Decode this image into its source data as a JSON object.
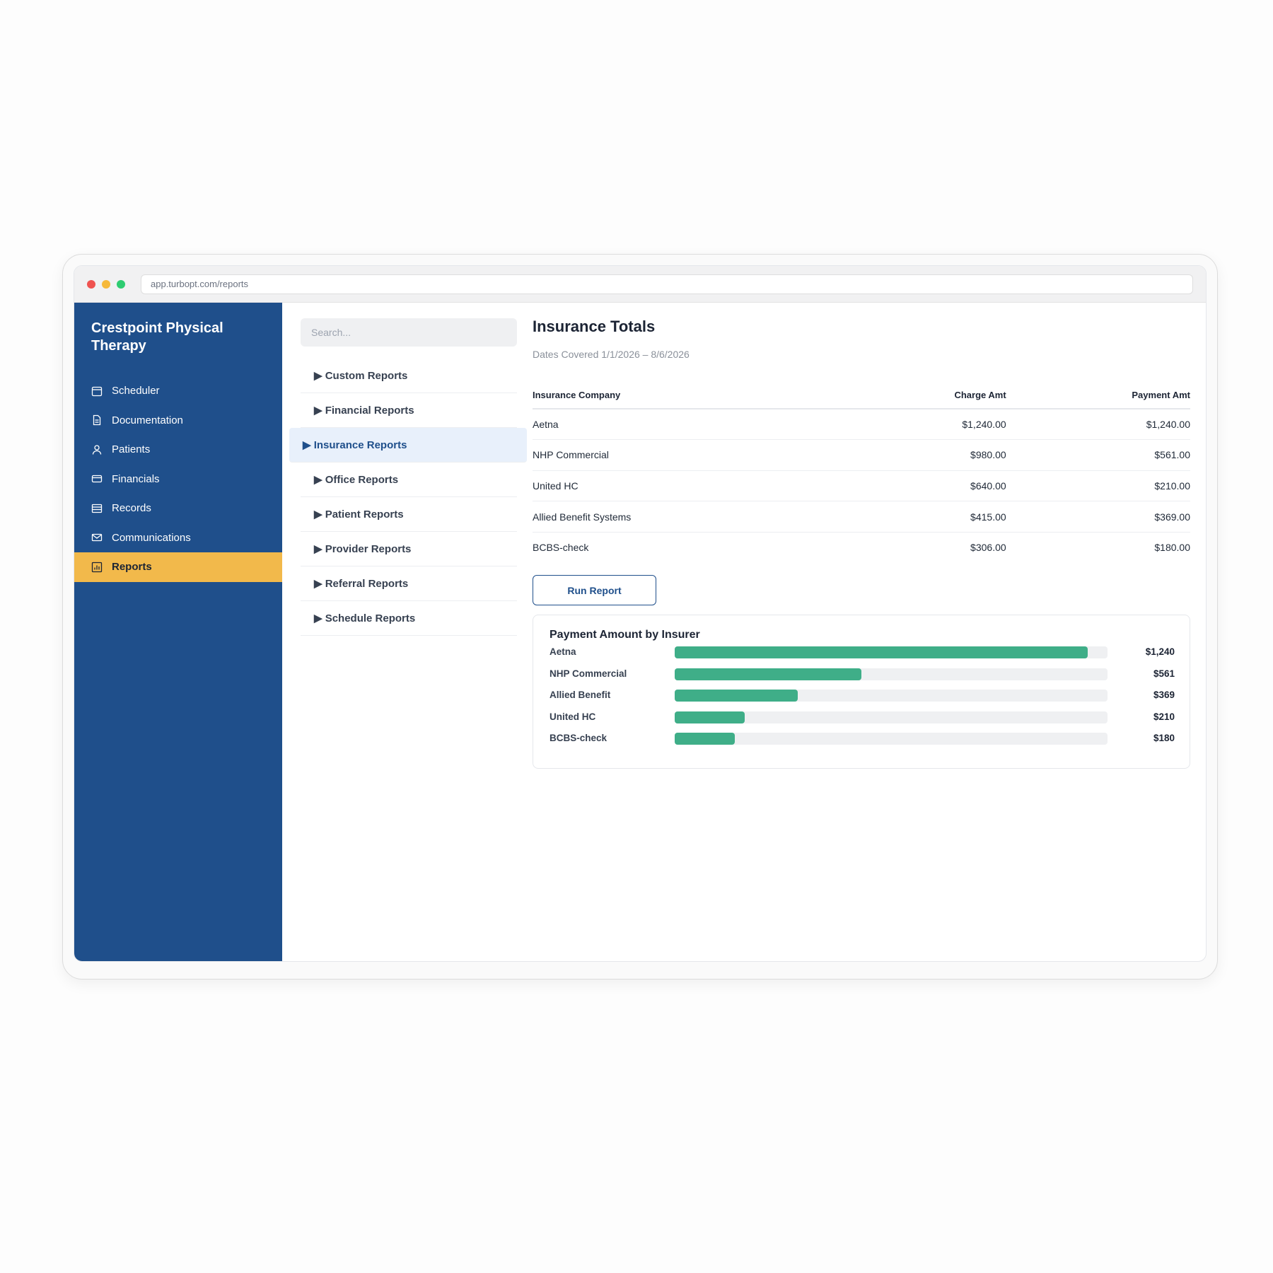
{
  "browser": {
    "url": "app.turbopt.com/reports"
  },
  "sidebar": {
    "brand": "Crestpoint Physical Therapy",
    "items": [
      {
        "label": "Scheduler",
        "icon": "calendar-icon",
        "active": false
      },
      {
        "label": "Documentation",
        "icon": "document-icon",
        "active": false
      },
      {
        "label": "Patients",
        "icon": "person-icon",
        "active": false
      },
      {
        "label": "Financials",
        "icon": "credit-card-icon",
        "active": false
      },
      {
        "label": "Records",
        "icon": "records-icon",
        "active": false
      },
      {
        "label": "Communications",
        "icon": "mail-icon",
        "active": false
      },
      {
        "label": "Reports",
        "icon": "chart-icon",
        "active": true
      }
    ]
  },
  "report_panel": {
    "search_placeholder": "Search...",
    "categories": [
      {
        "label": "▶ Custom Reports",
        "active": false
      },
      {
        "label": "▶ Financial Reports",
        "active": false
      },
      {
        "label": "▶ Insurance Reports",
        "active": true
      },
      {
        "label": "▶ Office Reports",
        "active": false
      },
      {
        "label": "▶ Patient Reports",
        "active": false
      },
      {
        "label": "▶ Provider Reports",
        "active": false
      },
      {
        "label": "▶ Referral Reports",
        "active": false
      },
      {
        "label": "▶ Schedule Reports",
        "active": false
      }
    ]
  },
  "main": {
    "title": "Insurance Totals",
    "dates": "Dates Covered 1/1/2026 – 8/6/2026",
    "table": {
      "headers": [
        "Insurance Company",
        "Charge Amt",
        "Payment Amt"
      ],
      "rows": [
        [
          "Aetna",
          "$1,240.00",
          "$1,240.00"
        ],
        [
          "NHP Commercial",
          "$980.00",
          "$561.00"
        ],
        [
          "United HC",
          "$640.00",
          "$210.00"
        ],
        [
          "Allied Benefit Systems",
          "$415.00",
          "$369.00"
        ],
        [
          "BCBS-check",
          "$306.00",
          "$180.00"
        ]
      ]
    },
    "run_button": "Run Report"
  },
  "colors": {
    "sidebar": "#1f4f8b",
    "active_nav": "#f2b94b",
    "bar": "#3fae88",
    "bar_track": "#eff0f2",
    "active_category": "#e8f0fb"
  },
  "chart_data": {
    "type": "bar",
    "orientation": "horizontal",
    "title": "Payment Amount by Insurer",
    "categories": [
      "Aetna",
      "NHP Commercial",
      "Allied Benefit",
      "United HC",
      "BCBS-check"
    ],
    "values": [
      1240,
      561,
      369,
      210,
      180
    ],
    "value_labels": [
      "$1,240",
      "$561",
      "$369",
      "$210",
      "$180"
    ],
    "xlim": [
      0,
      1300
    ]
  }
}
